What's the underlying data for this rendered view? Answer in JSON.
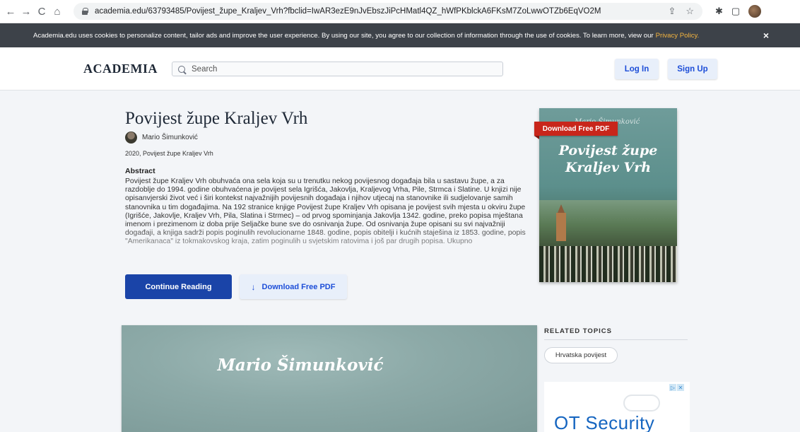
{
  "browser": {
    "url": "academia.edu/63793485/Povijest_župe_Kraljev_Vrh?fbclid=IwAR3ezE9nJvEbszJiPcHMatl4QZ_hWfPKblckA6FKsM7ZoLwwOTZb6EqVO2M",
    "nav_icons": [
      "←",
      "→",
      "C",
      "⌂"
    ],
    "url_icons": [
      "⇪",
      "☆"
    ],
    "ext_icons": [
      "✱",
      "▢"
    ]
  },
  "cookie_banner": {
    "text": "Academia.edu uses cookies to personalize content, tailor ads and improve the user experience. By using our site, you agree to our collection of information through the use of cookies. To learn more, view our",
    "link": "Privacy Policy.",
    "close": "×"
  },
  "header": {
    "logo": "ACADEMIA",
    "search_placeholder": "Search",
    "login": "Log In",
    "signup": "Sign Up"
  },
  "paper": {
    "title": "Povijest župe Kraljev Vrh",
    "author": "Mario Šimunković",
    "meta": "2020, Povijest župe Kraljev Vrh",
    "abstract_heading": "Abstract",
    "abstract": "Povijest župe Kraljev Vrh obuhvaća ona sela koja su u trenutku nekog povijesnog događaja bila u sastavu župe, a za razdoblje do 1994. godine obuhvaćena je povijest sela Igrišća, Jakovlja, Kraljevog Vrha, Pile, Strmca i Slatine. U knjizi nije opisanvjerski život već i širi kontekst najvažnijih povijesnih događaja i njihov utjecaj na stanovnike ili sudjelovanje samih stanovnika u tim događajima. Na 192 stranice knjige Povijest župe Kraljev Vrh opisana je povijest svih mjesta u okviru župe (Igrišće, Jakovlje, Kraljev Vrh, Pila, Slatina i Strmec) – od prvog spominjanja Jakovlja 1342. godine, preko popisa mještana imenom i prezimenom iz doba prije Seljačke bune sve do osnivanja župe. Od osnivanja župe opisani su svi najvažniji događaji, a knjiga sadrži popis poginulih revolucionarne 1848. godine, popis obitelji i kućnih staješina iz 1853. godine, popis \"Amerikanaca\" iz tokmakovskog kraja, zatim poginulih u svjetskim ratovima i još par drugih popisa. Ukupno",
    "continue_button": "Continue Reading",
    "download_button": "Download Free PDF",
    "download_arrow": "↓"
  },
  "cover": {
    "badge": "Download Free PDF",
    "author": "Mario Šimunković",
    "title": "Povijest župe Kraljev Vrh"
  },
  "preview": {
    "author": "Mario Šimunković"
  },
  "sidebar": {
    "related_heading": "RELATED TOPICS",
    "topics": [
      "Hrvatska povijest"
    ]
  },
  "ad": {
    "choices": [
      "▷",
      "✕"
    ],
    "text": "OT Security"
  }
}
